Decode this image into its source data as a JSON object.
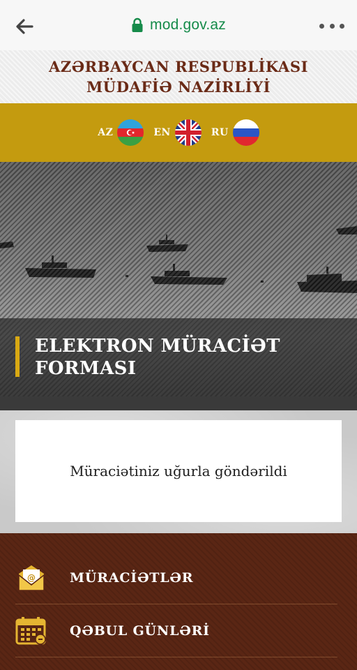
{
  "browser": {
    "url": "mod.gov.az",
    "icons": {
      "back": "arrow-left-icon",
      "lock": "lock-icon",
      "menu": "more-dots-icon"
    }
  },
  "header": {
    "title_line1": "AZƏRBAYCAN RESPUBLİKASI",
    "title_line2": "MÜDAFİƏ NAZİRLİYİ",
    "title_color": "#6a2a16"
  },
  "languages": [
    {
      "code": "AZ",
      "flag": "azerbaijan-flag-icon"
    },
    {
      "code": "EN",
      "flag": "uk-flag-icon"
    },
    {
      "code": "RU",
      "flag": "russia-flag-icon"
    }
  ],
  "hero": {
    "title_line1": "ELEKTRON MÜRACİƏT",
    "title_line2": "FORMASI",
    "accent_color": "#d9a913"
  },
  "success": {
    "message": "Müraciətiniz uğurla göndərildi"
  },
  "footer_menu": {
    "items": [
      {
        "label": "MÜRACİƏTLƏR",
        "icon": "mail-envelope-icon"
      },
      {
        "label": "QƏBUL GÜNLƏRİ",
        "icon": "calendar-icon"
      }
    ]
  },
  "colors": {
    "lang_bar": "#c49b0f",
    "footer_bg": "#5a2614",
    "url_green": "#168b4a"
  }
}
